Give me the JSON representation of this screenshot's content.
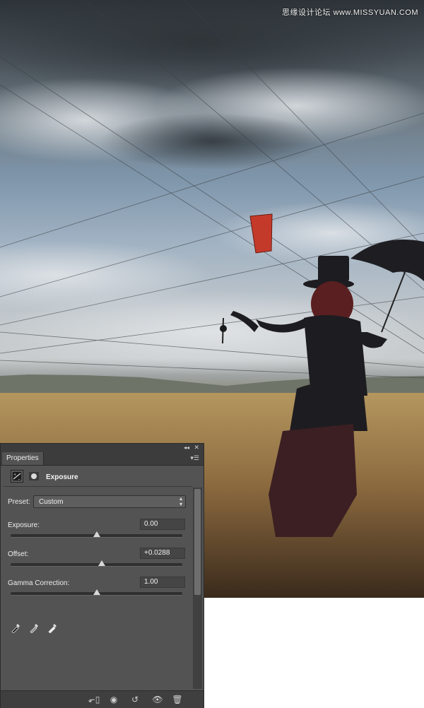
{
  "watermark": "思缘设计论坛 www.MISSYUAN.COM",
  "panel": {
    "tab_label": "Properties",
    "title": "Exposure",
    "preset": {
      "label": "Preset:",
      "value": "Custom"
    },
    "controls": [
      {
        "label": "Exposure:",
        "value": "0.00",
        "slider_fraction": 0.5
      },
      {
        "label": "Offset:",
        "value": "+0.0288",
        "slider_fraction": 0.53
      },
      {
        "label": "Gamma Correction:",
        "value": "1.00",
        "slider_fraction": 0.5
      }
    ],
    "eyedroppers": [
      "black-point-eyedropper-icon",
      "gray-point-eyedropper-icon",
      "white-point-eyedropper-icon"
    ],
    "bottom_buttons": [
      "clip-to-layer-icon",
      "view-previous-state-icon",
      "reset-icon",
      "visibility-eye-icon",
      "trash-icon"
    ]
  },
  "colors": {
    "panel_bg": "#535353",
    "accent": "#c43a2a"
  }
}
